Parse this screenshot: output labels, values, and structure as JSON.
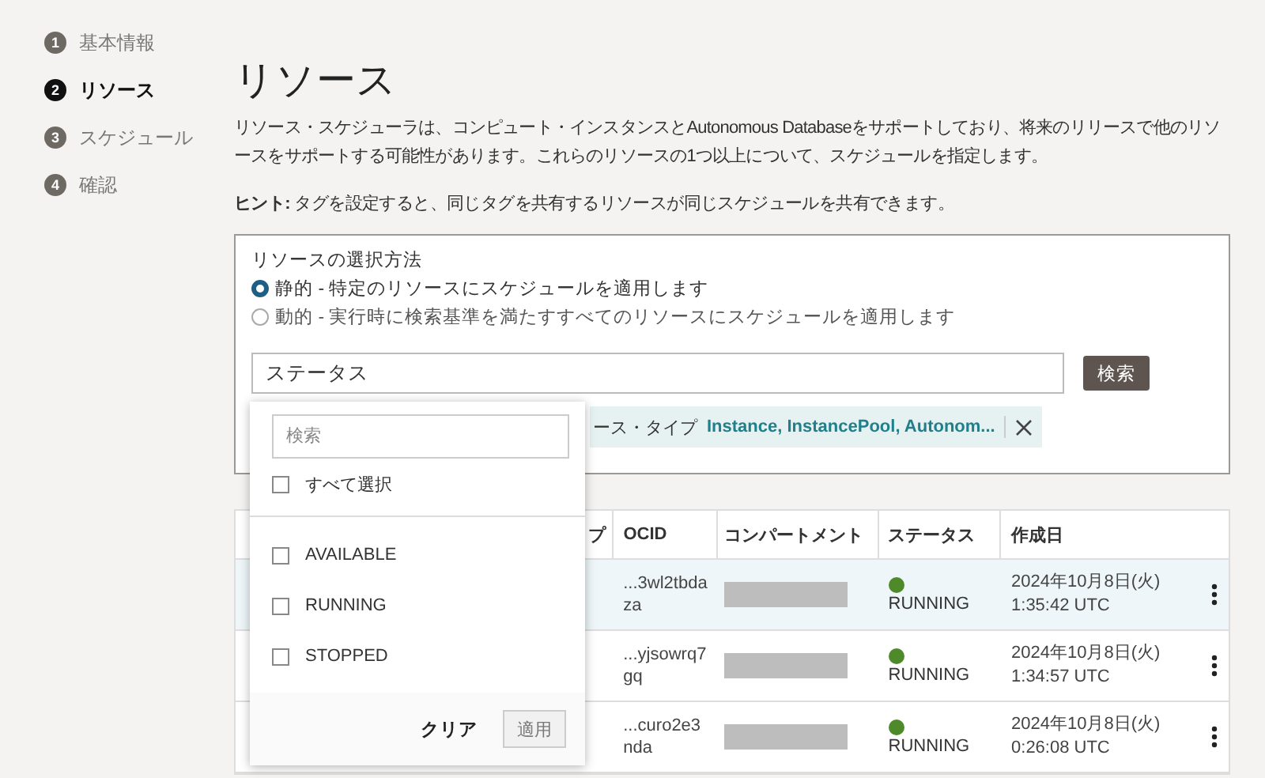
{
  "steps": [
    {
      "number": "1",
      "label": "基本情報",
      "selected": false
    },
    {
      "number": "2",
      "label": "リソース",
      "selected": true
    },
    {
      "number": "3",
      "label": "スケジュール",
      "selected": false
    },
    {
      "number": "4",
      "label": "確認",
      "selected": false
    }
  ],
  "title": "リソース",
  "description": "リソース・スケジューラは、コンピュート・インスタンスとAutonomous Databaseをサポートしており、将来のリリースで他のリソースをサポートする可能性があります。これらのリソースの1つ以上について、スケジュールを指定します。",
  "hint": "**ヒント:** タグを設定すると、同じタグを共有するリソースが同じスケジュールを共有できます。",
  "selector": {
    "label": "リソースの選択方法",
    "options": [
      {
        "label": "静的 - 特定のリソースにスケジュールを適用します",
        "selected": true
      },
      {
        "label": "動的 - 実行時に検索基準を満たすすべてのリソースにスケジュールを適用します",
        "selected": false
      }
    ],
    "search_field": {
      "value": "ステータス"
    },
    "search_button": "検索",
    "chip": {
      "label": "ース・タイプ",
      "value": "Instance, InstancePool, Autonom..."
    }
  },
  "table": {
    "columns": [
      "プ",
      "OCID",
      "コンパートメント",
      "ステータス",
      "作成日"
    ],
    "rows": [
      {
        "ocid": "...3wl2tbdaza",
        "status": "RUNNING",
        "created": "2024年10月8日(火) 1:35:42 UTC",
        "selected": true
      },
      {
        "ocid": "...yjsowrq7gq",
        "status": "RUNNING",
        "created": "2024年10月8日(火) 1:34:57 UTC",
        "selected": false
      },
      {
        "ocid": "...curo2e3nda",
        "status": "RUNNING",
        "created": "2024年10月8日(火) 0:26:08 UTC",
        "selected": false
      }
    ]
  },
  "dropdown": {
    "search_placeholder": "検索",
    "select_all": {
      "label": "すべて選択",
      "checked": false
    },
    "options": [
      {
        "label": "AVAILABLE",
        "checked": false
      },
      {
        "label": "RUNNING",
        "checked": false
      },
      {
        "label": "STOPPED",
        "checked": false
      }
    ],
    "clear": "クリア",
    "apply": "適用"
  }
}
